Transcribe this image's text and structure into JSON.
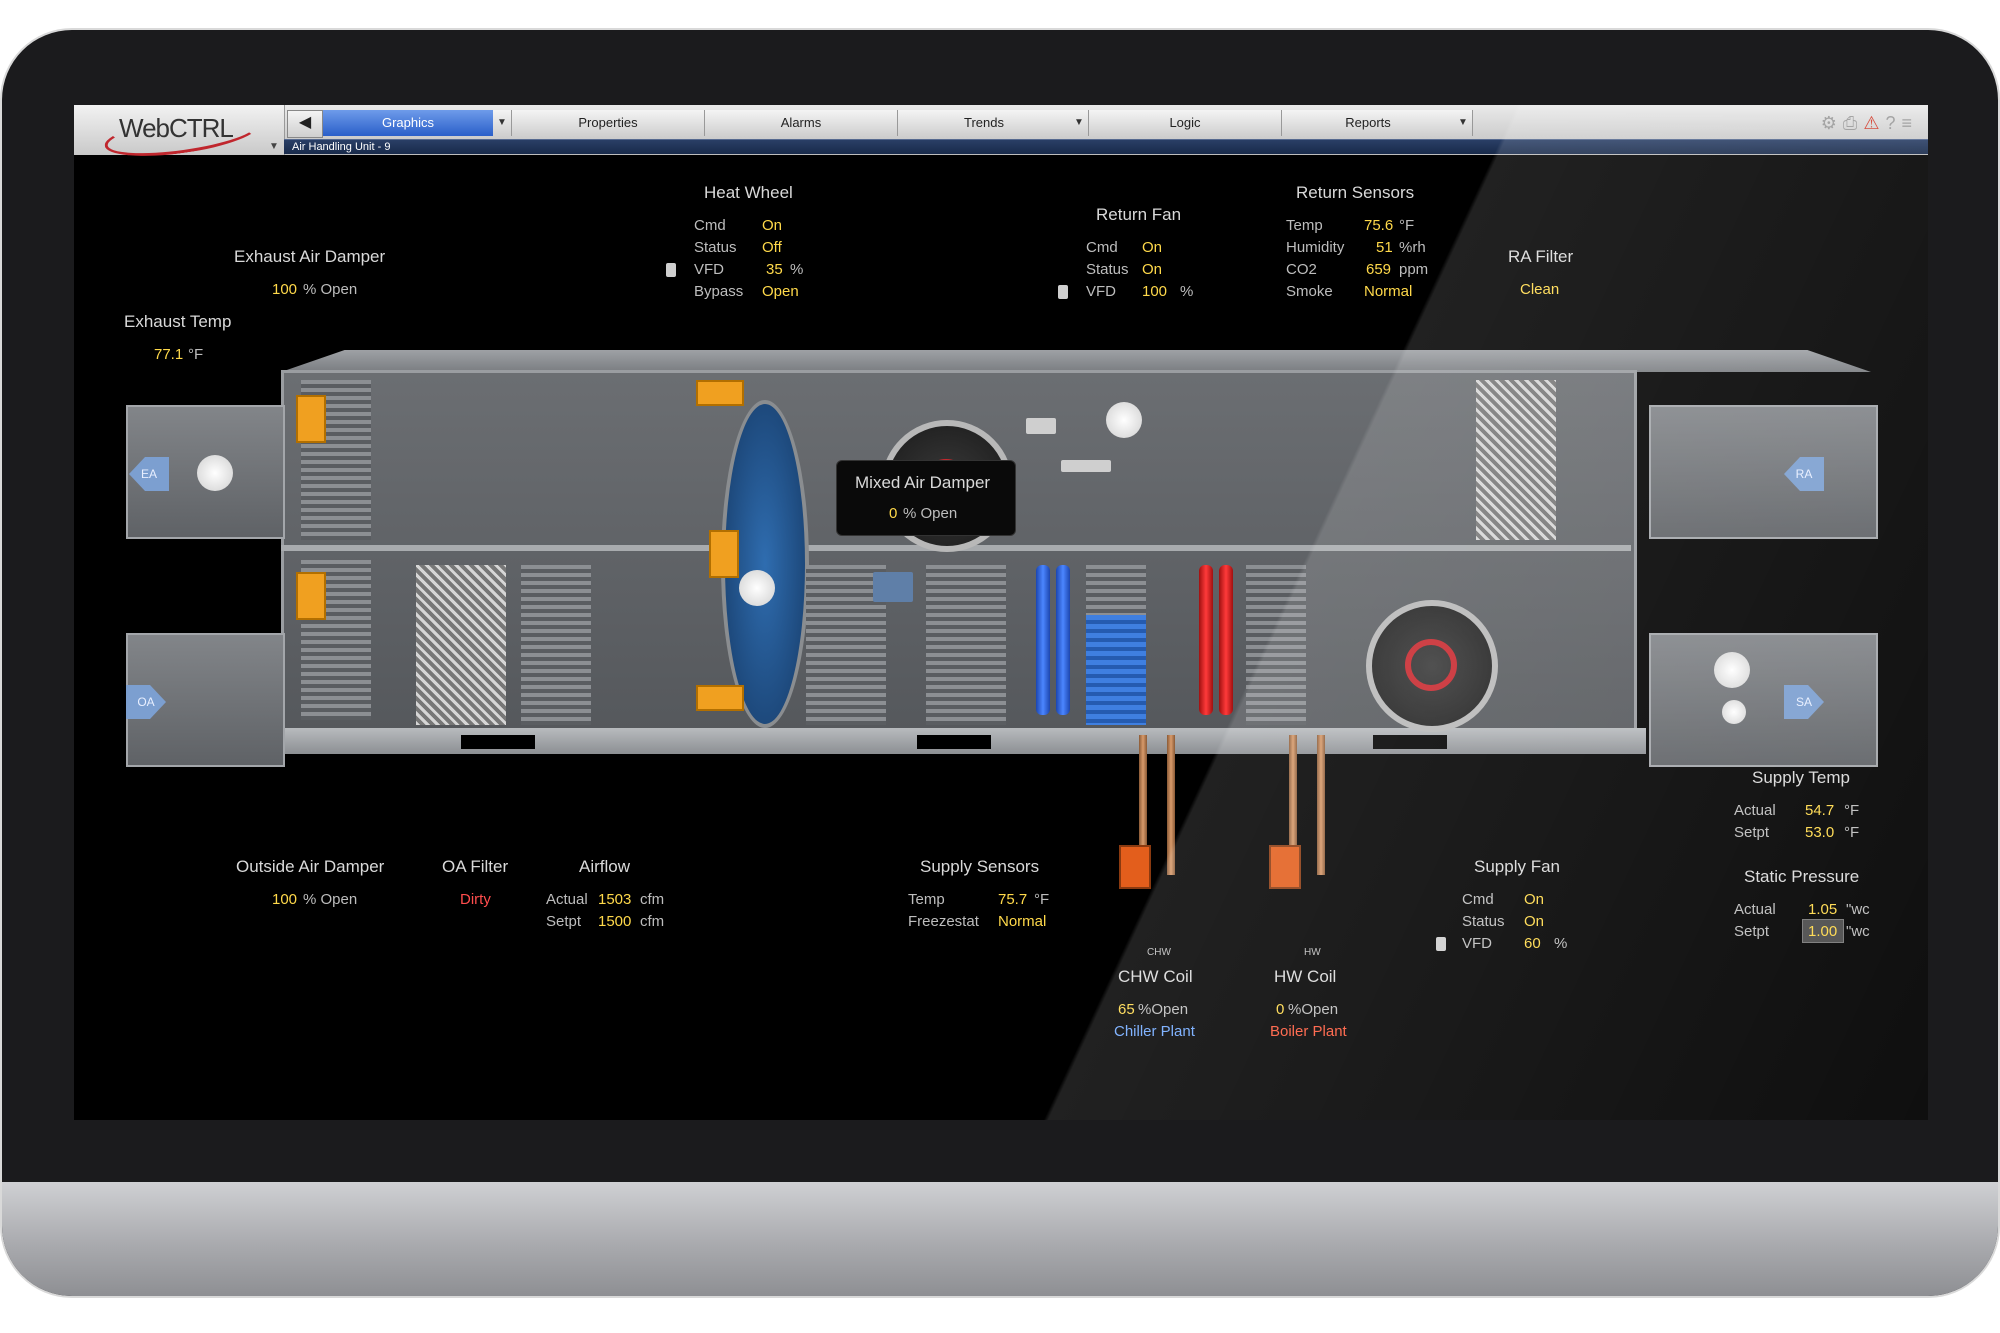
{
  "app": {
    "logo_text": "WebCTRL",
    "breadcrumb": "Air Handling Unit - 9"
  },
  "tabs": [
    {
      "label": "Graphics",
      "active": true
    },
    {
      "label": "Properties"
    },
    {
      "label": "Alarms"
    },
    {
      "label": "Trends"
    },
    {
      "label": "Logic"
    },
    {
      "label": "Reports"
    }
  ],
  "icons": {
    "back": "back-arrow-icon",
    "dropdown": "chevron-down-icon",
    "toolbar": [
      "equipment-icon",
      "print-icon",
      "alarm-warning-icon",
      "help-icon",
      "menu-icon"
    ]
  },
  "colors": {
    "value": "#ffd94a",
    "label": "#bdbdbd",
    "alarm": "#ff4d4d",
    "chw": "#6fa8ff",
    "hw": "#ff5a3c",
    "tab_active": "#2a5fc9"
  },
  "exhaust_air_damper": {
    "title": "Exhaust Air Damper",
    "value": "100",
    "unit": "% Open"
  },
  "exhaust_temp": {
    "title": "Exhaust Temp",
    "value": "77.1",
    "unit": "°F"
  },
  "heat_wheel": {
    "title": "Heat Wheel",
    "rows": [
      {
        "label": "Cmd",
        "value": "On",
        "unit": ""
      },
      {
        "label": "Status",
        "value": "Off",
        "unit": ""
      },
      {
        "label": "VFD",
        "value": "35",
        "unit": "%"
      },
      {
        "label": "Bypass",
        "value": "Open",
        "unit": ""
      }
    ]
  },
  "return_fan": {
    "title": "Return Fan",
    "rows": [
      {
        "label": "Cmd",
        "value": "On",
        "unit": ""
      },
      {
        "label": "Status",
        "value": "On",
        "unit": ""
      },
      {
        "label": "VFD",
        "value": "100",
        "unit": "%"
      }
    ]
  },
  "return_sensors": {
    "title": "Return Sensors",
    "rows": [
      {
        "label": "Temp",
        "value": "75.6",
        "unit": "°F"
      },
      {
        "label": "Humidity",
        "value": "51",
        "unit": "%rh"
      },
      {
        "label": "CO2",
        "value": "659",
        "unit": "ppm"
      },
      {
        "label": "Smoke",
        "value": "Normal",
        "unit": ""
      }
    ]
  },
  "ra_filter": {
    "title": "RA Filter",
    "value": "Clean"
  },
  "mixed_air_damper": {
    "title": "Mixed Air Damper",
    "value": "0",
    "unit": "% Open"
  },
  "duct_labels": {
    "ea": "EA",
    "oa": "OA",
    "ra": "RA",
    "sa": "SA"
  },
  "outside_air_damper": {
    "title": "Outside Air Damper",
    "value": "100",
    "unit": "% Open"
  },
  "oa_filter": {
    "title": "OA Filter",
    "value": "Dirty"
  },
  "airflow": {
    "title": "Airflow",
    "rows": [
      {
        "label": "Actual",
        "value": "1503",
        "unit": "cfm"
      },
      {
        "label": "Setpt",
        "value": "1500",
        "unit": "cfm"
      }
    ]
  },
  "supply_sensors": {
    "title": "Supply Sensors",
    "rows": [
      {
        "label": "Temp",
        "value": "75.7",
        "unit": "°F"
      },
      {
        "label": "Freezestat",
        "value": "Normal",
        "unit": ""
      }
    ]
  },
  "chw_coil": {
    "small": "CHW",
    "title": "CHW Coil",
    "value": "65",
    "unit": "%Open",
    "link": "Chiller Plant"
  },
  "hw_coil": {
    "small": "HW",
    "title": "HW Coil",
    "value": "0",
    "unit": "%Open",
    "link": "Boiler Plant"
  },
  "supply_fan": {
    "title": "Supply Fan",
    "rows": [
      {
        "label": "Cmd",
        "value": "On",
        "unit": ""
      },
      {
        "label": "Status",
        "value": "On",
        "unit": ""
      },
      {
        "label": "VFD",
        "value": "60",
        "unit": "%"
      }
    ]
  },
  "supply_temp": {
    "title": "Supply Temp",
    "rows": [
      {
        "label": "Actual",
        "value": "54.7",
        "unit": "°F"
      },
      {
        "label": "Setpt",
        "value": "53.0",
        "unit": "°F"
      }
    ]
  },
  "static_pressure": {
    "title": "Static Pressure",
    "rows": [
      {
        "label": "Actual",
        "value": "1.05",
        "unit": "\"wc"
      },
      {
        "label": "Setpt",
        "value": "1.00",
        "unit": "\"wc"
      }
    ]
  }
}
